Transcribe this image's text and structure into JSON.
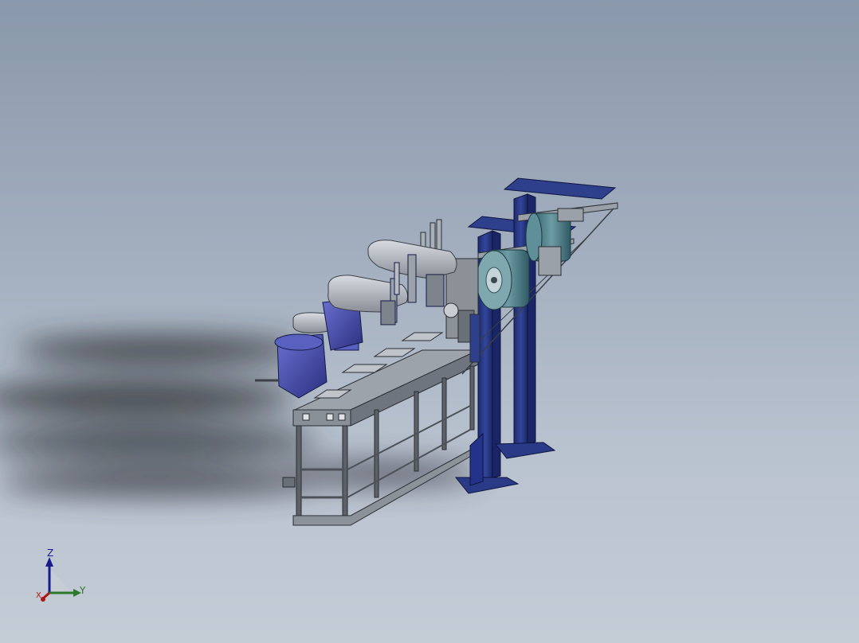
{
  "viewport": {
    "background_top": "#8998aa",
    "background_bottom": "#c4ccd6"
  },
  "model": {
    "frame_color": "#2e3f8c",
    "robot_color": "#4a4fb0",
    "arm_color": "#b8bcc4",
    "roll_color": "#4a7e88",
    "rail_color": "#6e737a"
  },
  "triad": {
    "z_label": "Z",
    "y_label": "Y",
    "x_label": "X",
    "z_color": "#1a1a88",
    "y_color": "#2a7a2a",
    "x_color": "#b01414"
  }
}
